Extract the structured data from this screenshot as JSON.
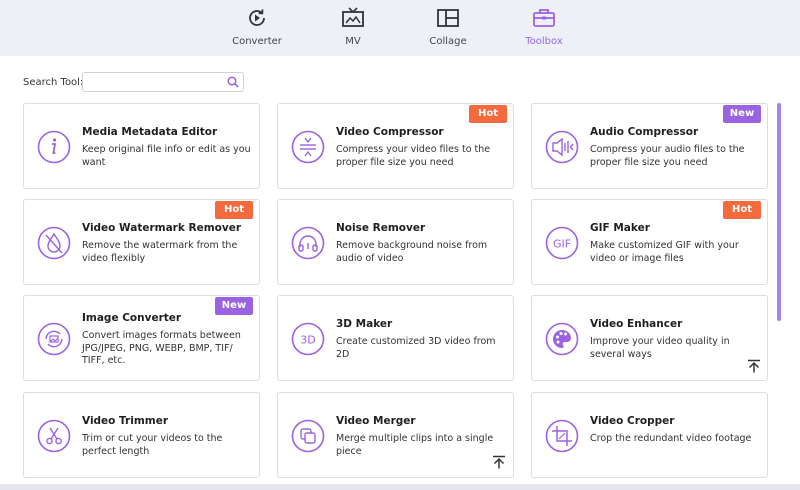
{
  "nav": {
    "items": [
      {
        "label": "Converter",
        "icon": "refresh-play-icon"
      },
      {
        "label": "MV",
        "icon": "tv-icon"
      },
      {
        "label": "Collage",
        "icon": "collage-grid-icon"
      },
      {
        "label": "Toolbox",
        "icon": "toolbox-icon",
        "active": true
      }
    ]
  },
  "search": {
    "label": "Search Tool:",
    "value": "",
    "placeholder": ""
  },
  "tools": [
    {
      "title": "Media Metadata Editor",
      "desc": "Keep original file info or edit as you want",
      "icon": "info-icon"
    },
    {
      "title": "Video Compressor",
      "desc": "Compress your video files to the proper file size you need",
      "icon": "compress-icon",
      "badge": "Hot"
    },
    {
      "title": "Audio Compressor",
      "desc": "Compress your audio files to the proper file size you need",
      "icon": "audio-compress-icon",
      "badge": "New"
    },
    {
      "title": "Video Watermark Remover",
      "desc": "Remove the watermark from the video flexibly",
      "icon": "watermark-remove-icon",
      "badge": "Hot"
    },
    {
      "title": "Noise Remover",
      "desc": "Remove background noise from audio of video",
      "icon": "headphones-icon"
    },
    {
      "title": "GIF Maker",
      "desc": "Make customized GIF with your video or image files",
      "icon": "gif-icon",
      "badge": "Hot"
    },
    {
      "title": "Image Converter",
      "desc": "Convert images formats between JPG/JPEG, PNG, WEBP, BMP, TIF/ TIFF, etc.",
      "icon": "image-convert-icon",
      "badge": "New"
    },
    {
      "title": "3D Maker",
      "desc": "Create customized 3D video from 2D",
      "icon": "3d-icon",
      "icon_text": "3D"
    },
    {
      "title": "Video Enhancer",
      "desc": "Improve your video quality in several ways",
      "icon": "palette-icon"
    },
    {
      "title": "Video Trimmer",
      "desc": "Trim or cut your videos to the perfect length",
      "icon": "scissors-icon"
    },
    {
      "title": "Video Merger",
      "desc": "Merge multiple clips into a single piece",
      "icon": "merge-icon"
    },
    {
      "title": "Video Cropper",
      "desc": "Crop the redundant video footage",
      "icon": "crop-icon"
    }
  ],
  "colors": {
    "accent": "#9a63e2",
    "hot": "#f36b3d",
    "new": "#9a63e2"
  }
}
